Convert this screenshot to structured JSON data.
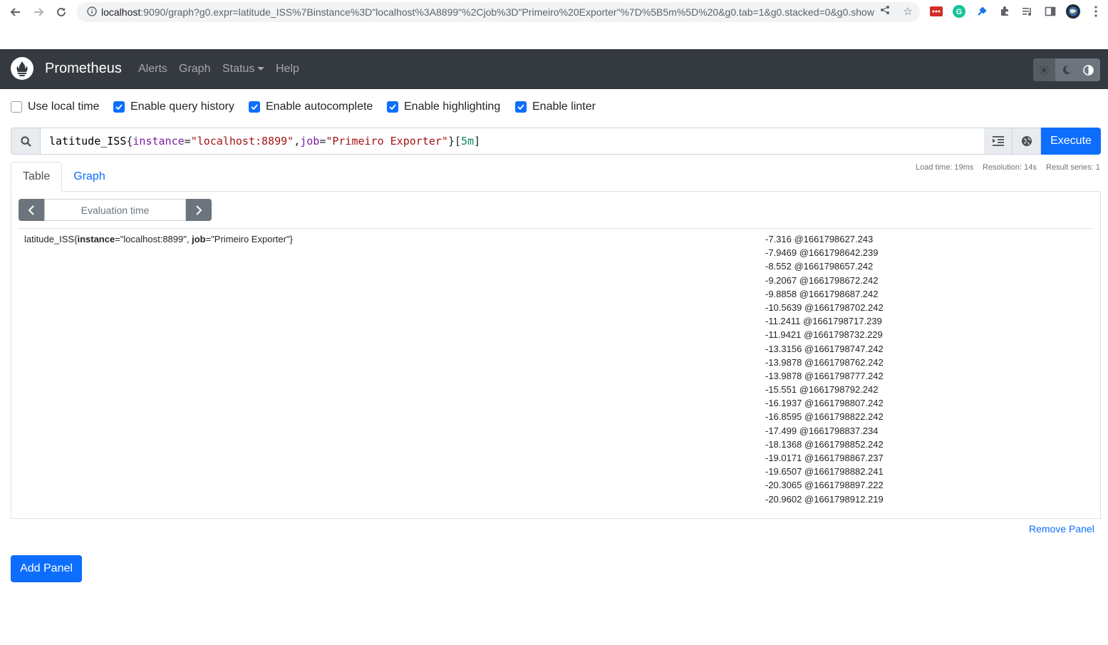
{
  "browser": {
    "url_host": "localhost",
    "url_rest": ":9090/graph?g0.expr=latitude_ISS%7Binstance%3D\"localhost%3A8899\"%2Cjob%3D\"Primeiro%20Exporter\"%7D%5B5m%5D%20&g0.tab=1&g0.stacked=0&g0.show…"
  },
  "navbar": {
    "brand": "Prometheus",
    "links": [
      "Alerts",
      "Graph",
      "Status",
      "Help"
    ]
  },
  "options": [
    {
      "label": "Use local time",
      "checked": false
    },
    {
      "label": "Enable query history",
      "checked": true
    },
    {
      "label": "Enable autocomplete",
      "checked": true
    },
    {
      "label": "Enable highlighting",
      "checked": true
    },
    {
      "label": "Enable linter",
      "checked": true
    }
  ],
  "expression": {
    "metric": "latitude_ISS",
    "open_brace": "{",
    "label1_key": "instance",
    "eq1": "=",
    "label1_val": "\"localhost:8899\"",
    "comma": ",",
    "label2_key": "job",
    "eq2": "=",
    "label2_val": "\"Primeiro Exporter\"",
    "close_brace": "}",
    "range_open": "[",
    "range": "5m",
    "range_close": "]"
  },
  "execute_label": "Execute",
  "stats": {
    "load_time": "Load time: 19ms",
    "resolution": "Resolution: 14s",
    "result_series": "Result series: 1"
  },
  "tabs": [
    "Table",
    "Graph"
  ],
  "eval_time_placeholder": "Evaluation time",
  "series": {
    "metric": "latitude_ISS",
    "open": "{",
    "k1": "instance",
    "v1": "=\"localhost:8899\", ",
    "k2": "job",
    "v2": "=\"Primeiro Exporter\"",
    "close": "}"
  },
  "values": [
    "-7.316 @1661798627.243",
    "-7.9469 @1661798642.239",
    "-8.552 @1661798657.242",
    "-9.2067 @1661798672.242",
    "-9.8858 @1661798687.242",
    "-10.5639 @1661798702.242",
    "-11.2411 @1661798717.239",
    "-11.9421 @1661798732.229",
    "-13.3156 @1661798747.242",
    "-13.9878 @1661798762.242",
    "-13.9878 @1661798777.242",
    "-15.551 @1661798792.242",
    "-16.1937 @1661798807.242",
    "-16.8595 @1661798822.242",
    "-17.499 @1661798837.234",
    "-18.1368 @1661798852.242",
    "-19.0171 @1661798867.237",
    "-19.6507 @1661798882.241",
    "-20.3065 @1661798897.222",
    "-20.9602 @1661798912.219"
  ],
  "remove_panel": "Remove Panel",
  "add_panel": "Add Panel"
}
